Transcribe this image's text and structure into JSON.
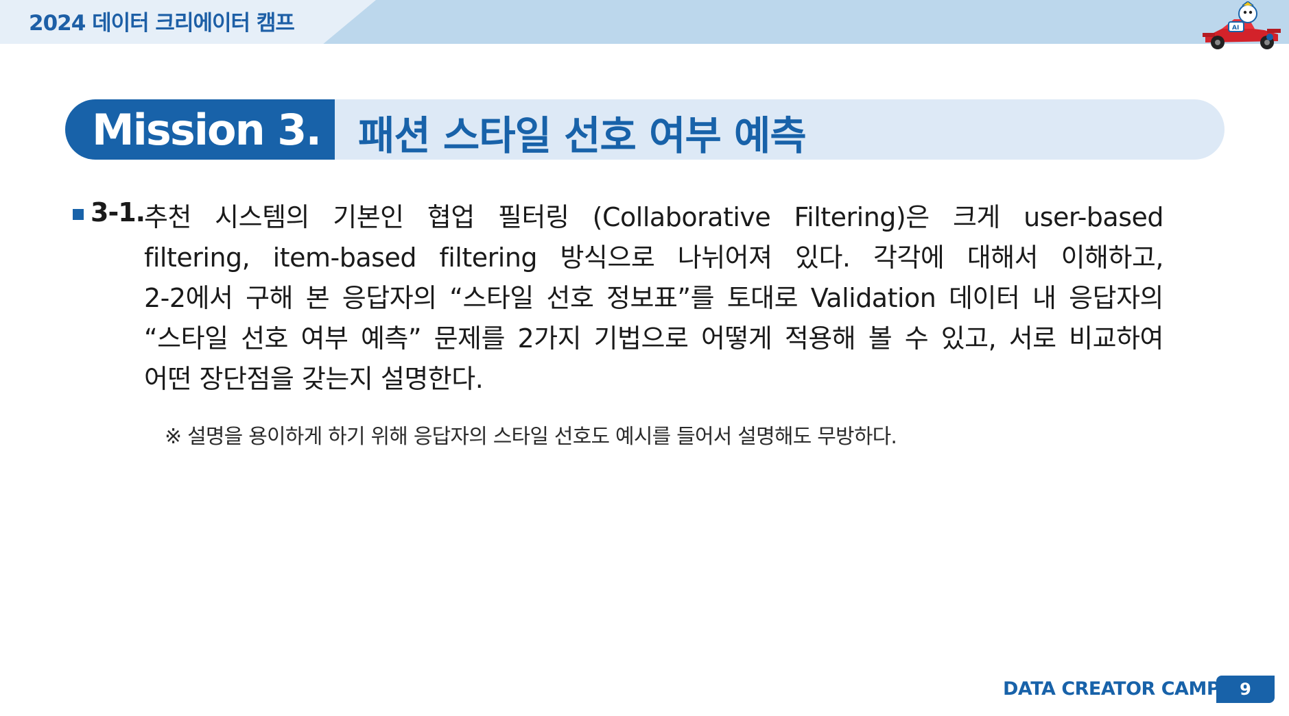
{
  "header": {
    "event_title": "2024 데이터 크리에이터 캠프"
  },
  "mission": {
    "tag": "Mission 3.",
    "title": "패션 스타일 선호 여부 예측"
  },
  "question": {
    "number": "3-1.",
    "lines": [
      "추천 시스템의 기본인 협업 필터링 (Collaborative Filtering)은 크게 user-based",
      "filtering, item-based filtering 방식으로 나뉘어져 있다. 각각에 대해서 이해하고,",
      "2-2에서 구해 본 응답자의 “스타일 선호 정보표”를 토대로 Validation 데이터 내 응답자의",
      "“스타일 선호 여부 예측” 문제를 2가지 기법으로 어떻게 적용해 볼 수 있고, 서로 비교하여",
      "어떤 장단점을 갖는지 설명한다."
    ],
    "note": "※ 설명을 용이하게 하기 위해 응답자의 스타일 선호도 예시를 들어서 설명해도 무방하다."
  },
  "footer": {
    "label": "DATA CREATOR CAMP",
    "page_number": "9"
  },
  "colors": {
    "brand_blue": "#1862a9",
    "light_blue": "#dde9f6",
    "banner_blue": "#bcd7ec"
  },
  "icons": {
    "mascot": "race-car-mascot-icon",
    "bullet": "square-bullet-icon"
  }
}
